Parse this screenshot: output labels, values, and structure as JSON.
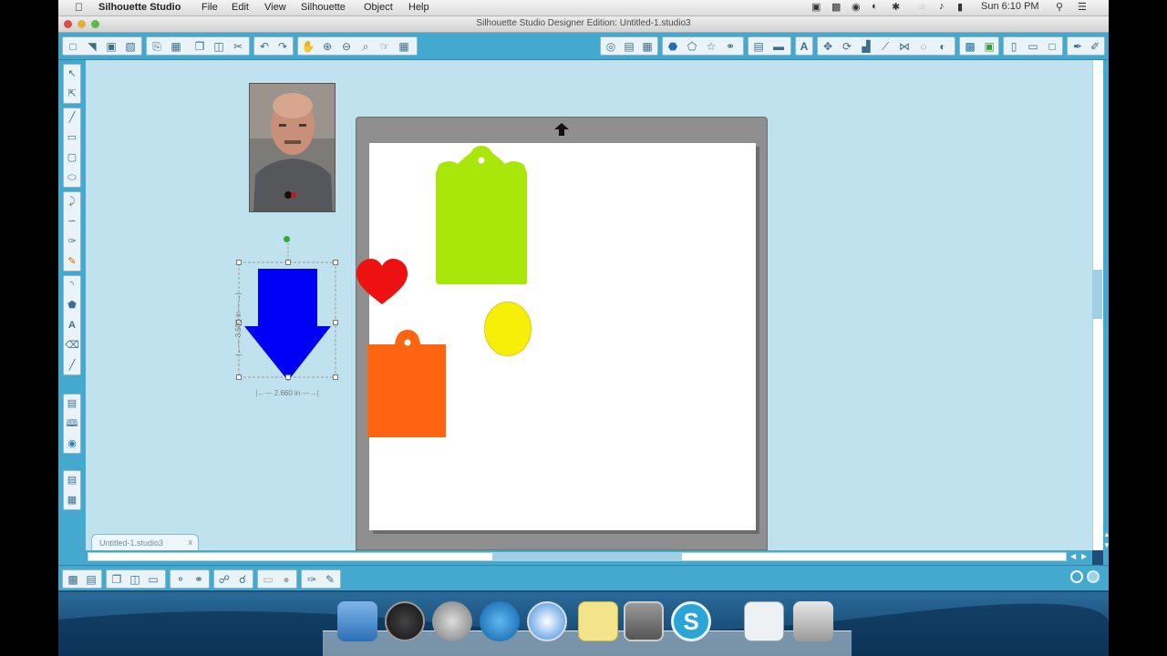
{
  "menubar": {
    "app_name": "Silhouette Studio",
    "items": [
      "File",
      "Edit",
      "View",
      "Silhouette",
      "Object",
      "Help"
    ],
    "clock": "Sun 6:10 PM"
  },
  "window": {
    "title": "Silhouette Studio Designer Edition: Untitled-1.studio3"
  },
  "document_tab": {
    "label": "Untitled-1.studio3",
    "close": "x"
  },
  "selection": {
    "width_label": "2.660 in",
    "height_label": "3.500 in"
  },
  "shapes": {
    "tag_green_color": "#a9e60a",
    "tag_orange_color": "#ff6410",
    "heart_color": "#ee1111",
    "oval_color": "#f6ef08",
    "arrow_color": "#0000f6"
  },
  "icons": {
    "toolbar_left": [
      "new-doc-icon",
      "open-icon",
      "save-icon",
      "save-as-icon",
      "print-icon",
      "print-cut-icon",
      "copy-icon",
      "paste-icon",
      "cut-icon",
      "undo-icon",
      "redo-icon",
      "pan-icon",
      "zoom-in-icon",
      "zoom-out-icon",
      "zoom-select-icon",
      "zoom-drag-icon",
      "fit-page-icon"
    ],
    "left_panel": [
      "select-icon",
      "point-edit-icon",
      "line-icon",
      "rectangle-icon",
      "rounded-rect-icon",
      "ellipse-icon",
      "polygon-icon",
      "curve-icon",
      "arc-icon",
      "freehand-icon",
      "smooth-freehand-icon",
      "text-icon",
      "eraser-icon",
      "knife-icon",
      "library-icon",
      "store-icon",
      "online-icon",
      "grid-icon",
      "layers-icon"
    ]
  }
}
